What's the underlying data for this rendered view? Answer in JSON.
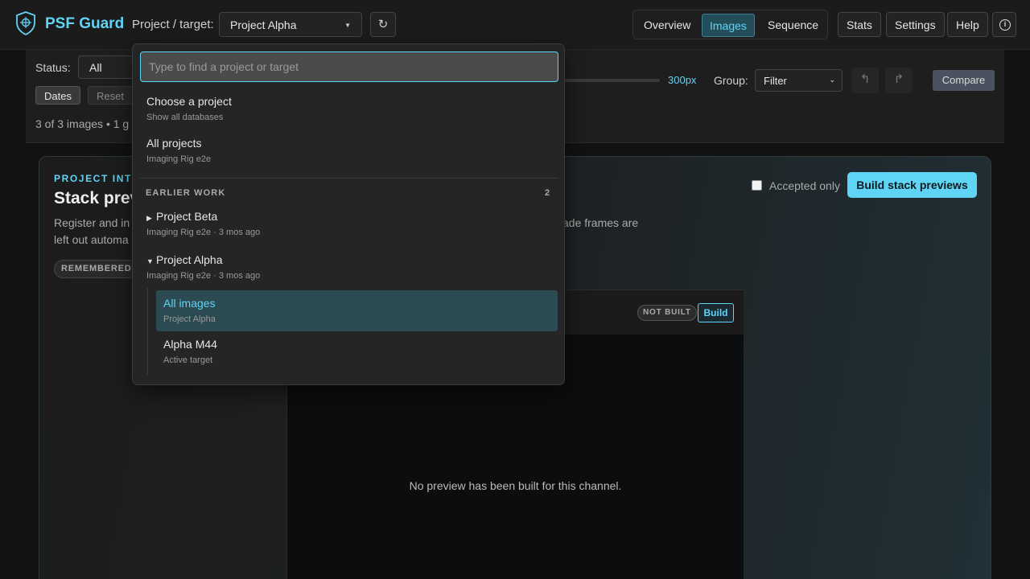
{
  "header": {
    "brand": "PSF Guard",
    "project_label": "Project / target:",
    "project_selected": "Project Alpha",
    "refresh_glyph": "↻",
    "nav_tabs": [
      {
        "label": "Overview"
      },
      {
        "label": "Images"
      },
      {
        "label": "Sequence"
      }
    ],
    "active_tab": "Images",
    "buttons": {
      "stats": "Stats",
      "settings": "Settings",
      "help": "Help"
    },
    "info_glyph": "i"
  },
  "toolbar": {
    "status_label": "Status:",
    "status_value": "All",
    "dates_label": "Dates",
    "reset_label": "Reset",
    "count_text": "3 of 3 images • 1 g",
    "size_value": "300px",
    "group_label": "Group:",
    "group_value": "Filter",
    "compare_label": "Compare"
  },
  "card": {
    "eyebrow": "PROJECT INTE",
    "title": "Stack prev",
    "desc_line1": "Register and in",
    "desc_line1_tail": "ade frames are",
    "desc_line2": "left out automa",
    "remembered_badge": "REMEMBERED",
    "accepted_only_label": "Accepted only",
    "accepted_only_checked": false,
    "build_all_label": "Build stack previews",
    "not_built_badge": "NOT BUILT",
    "build_label": "Build",
    "no_preview_text": "No preview has been built for this channel."
  },
  "dropdown": {
    "search_placeholder": "Type to find a project or target",
    "choose": {
      "title": "Choose a project",
      "subtitle": "Show all databases"
    },
    "all_projects": {
      "title": "All projects",
      "subtitle": "Imaging Rig e2e"
    },
    "section_label": "EARLIER WORK",
    "section_count": "2",
    "projects": [
      {
        "title": "Project Beta",
        "subtitle": "Imaging Rig e2e · 3 mos ago",
        "expanded": false
      },
      {
        "title": "Project Alpha",
        "subtitle": "Imaging Rig e2e · 3 mos ago",
        "expanded": true
      }
    ],
    "targets": [
      {
        "title": "All images",
        "subtitle": "Project Alpha",
        "selected": true
      },
      {
        "title": "Alpha M44",
        "subtitle": "Active target",
        "selected": false
      }
    ]
  },
  "colors": {
    "accent": "#5fd4f5",
    "background": "#121212",
    "panel": "#1e1e1e"
  }
}
